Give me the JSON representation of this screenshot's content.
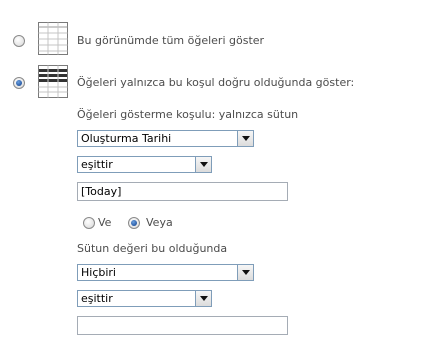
{
  "options": {
    "show_all_label": "Bu görünümde tüm öğeleri göster",
    "show_filtered_label": "Öğeleri yalnızca bu koşul doğru olduğunda göster:",
    "show_all_selected": false,
    "show_filtered_selected": true
  },
  "condition1": {
    "heading": "Öğeleri gösterme koşulu: yalnızca sütun",
    "column_value": "Oluşturma Tarihi",
    "operator_value": "eşittir",
    "value_text": "[Today]"
  },
  "logic": {
    "and_label": "Ve",
    "or_label": "Veya",
    "and_selected": false,
    "or_selected": true
  },
  "condition2": {
    "heading": "Sütun değeri bu olduğunda",
    "column_value": "Hiçbiri",
    "operator_value": "eşittir",
    "value_text": ""
  },
  "icons": {
    "all_items_icon": "grid-view-icon",
    "filtered_icon": "filtered-grid-icon"
  }
}
